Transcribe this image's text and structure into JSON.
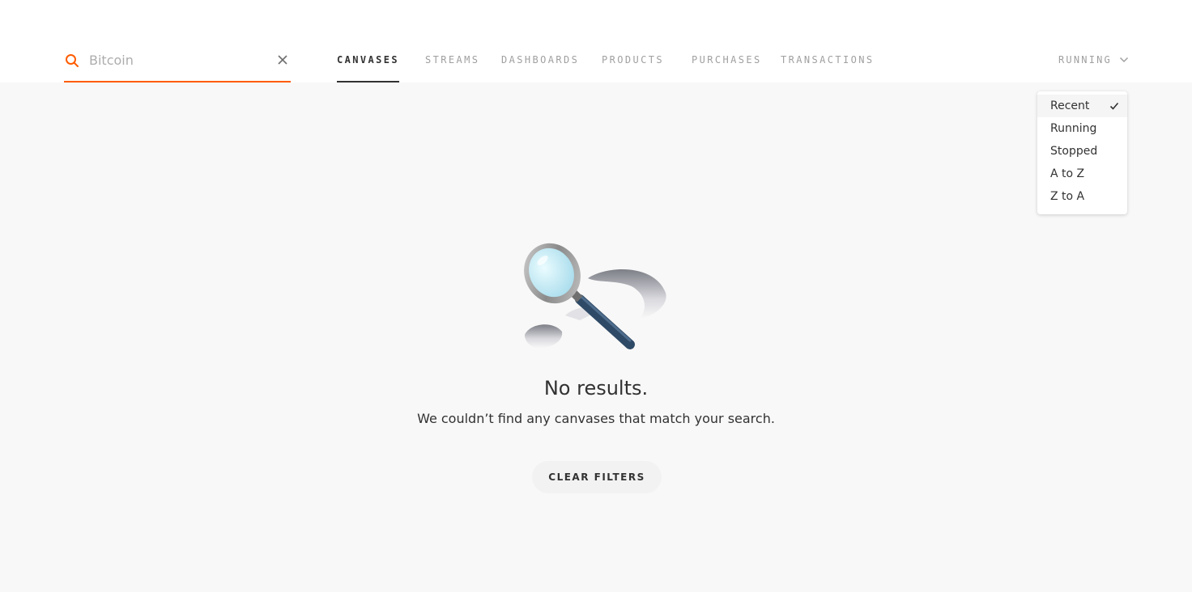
{
  "search": {
    "value": "",
    "placeholder": "Bitcoin"
  },
  "tabs": [
    {
      "label": "CANVASES",
      "active": true
    },
    {
      "label": "STREAMS",
      "active": false
    },
    {
      "label": "DASHBOARDS",
      "active": false
    },
    {
      "label": "PRODUCTS",
      "active": false
    },
    {
      "label": "PURCHASES",
      "active": false
    },
    {
      "label": "TRANSACTIONS",
      "active": false
    }
  ],
  "sort": {
    "label": "RUNNING",
    "options": [
      {
        "label": "Recent",
        "selected": true
      },
      {
        "label": "Running",
        "selected": false
      },
      {
        "label": "Stopped",
        "selected": false
      },
      {
        "label": "A to Z",
        "selected": false
      },
      {
        "label": "Z to A",
        "selected": false
      }
    ]
  },
  "empty_state": {
    "title": "No results.",
    "message": "We couldn’t find any canvases that match your search.",
    "button_label": "CLEAR FILTERS"
  },
  "icons": {
    "search": "search-icon",
    "clear": "close-icon",
    "sort": "chevron-down-icon",
    "check": "check-icon",
    "illustration": "magnifying-glass-illustration"
  },
  "colors": {
    "accent": "#ff5c00",
    "text": "#323232",
    "muted": "#a0a0a0",
    "background": "#f8f8f8",
    "header": "#ffffff"
  }
}
